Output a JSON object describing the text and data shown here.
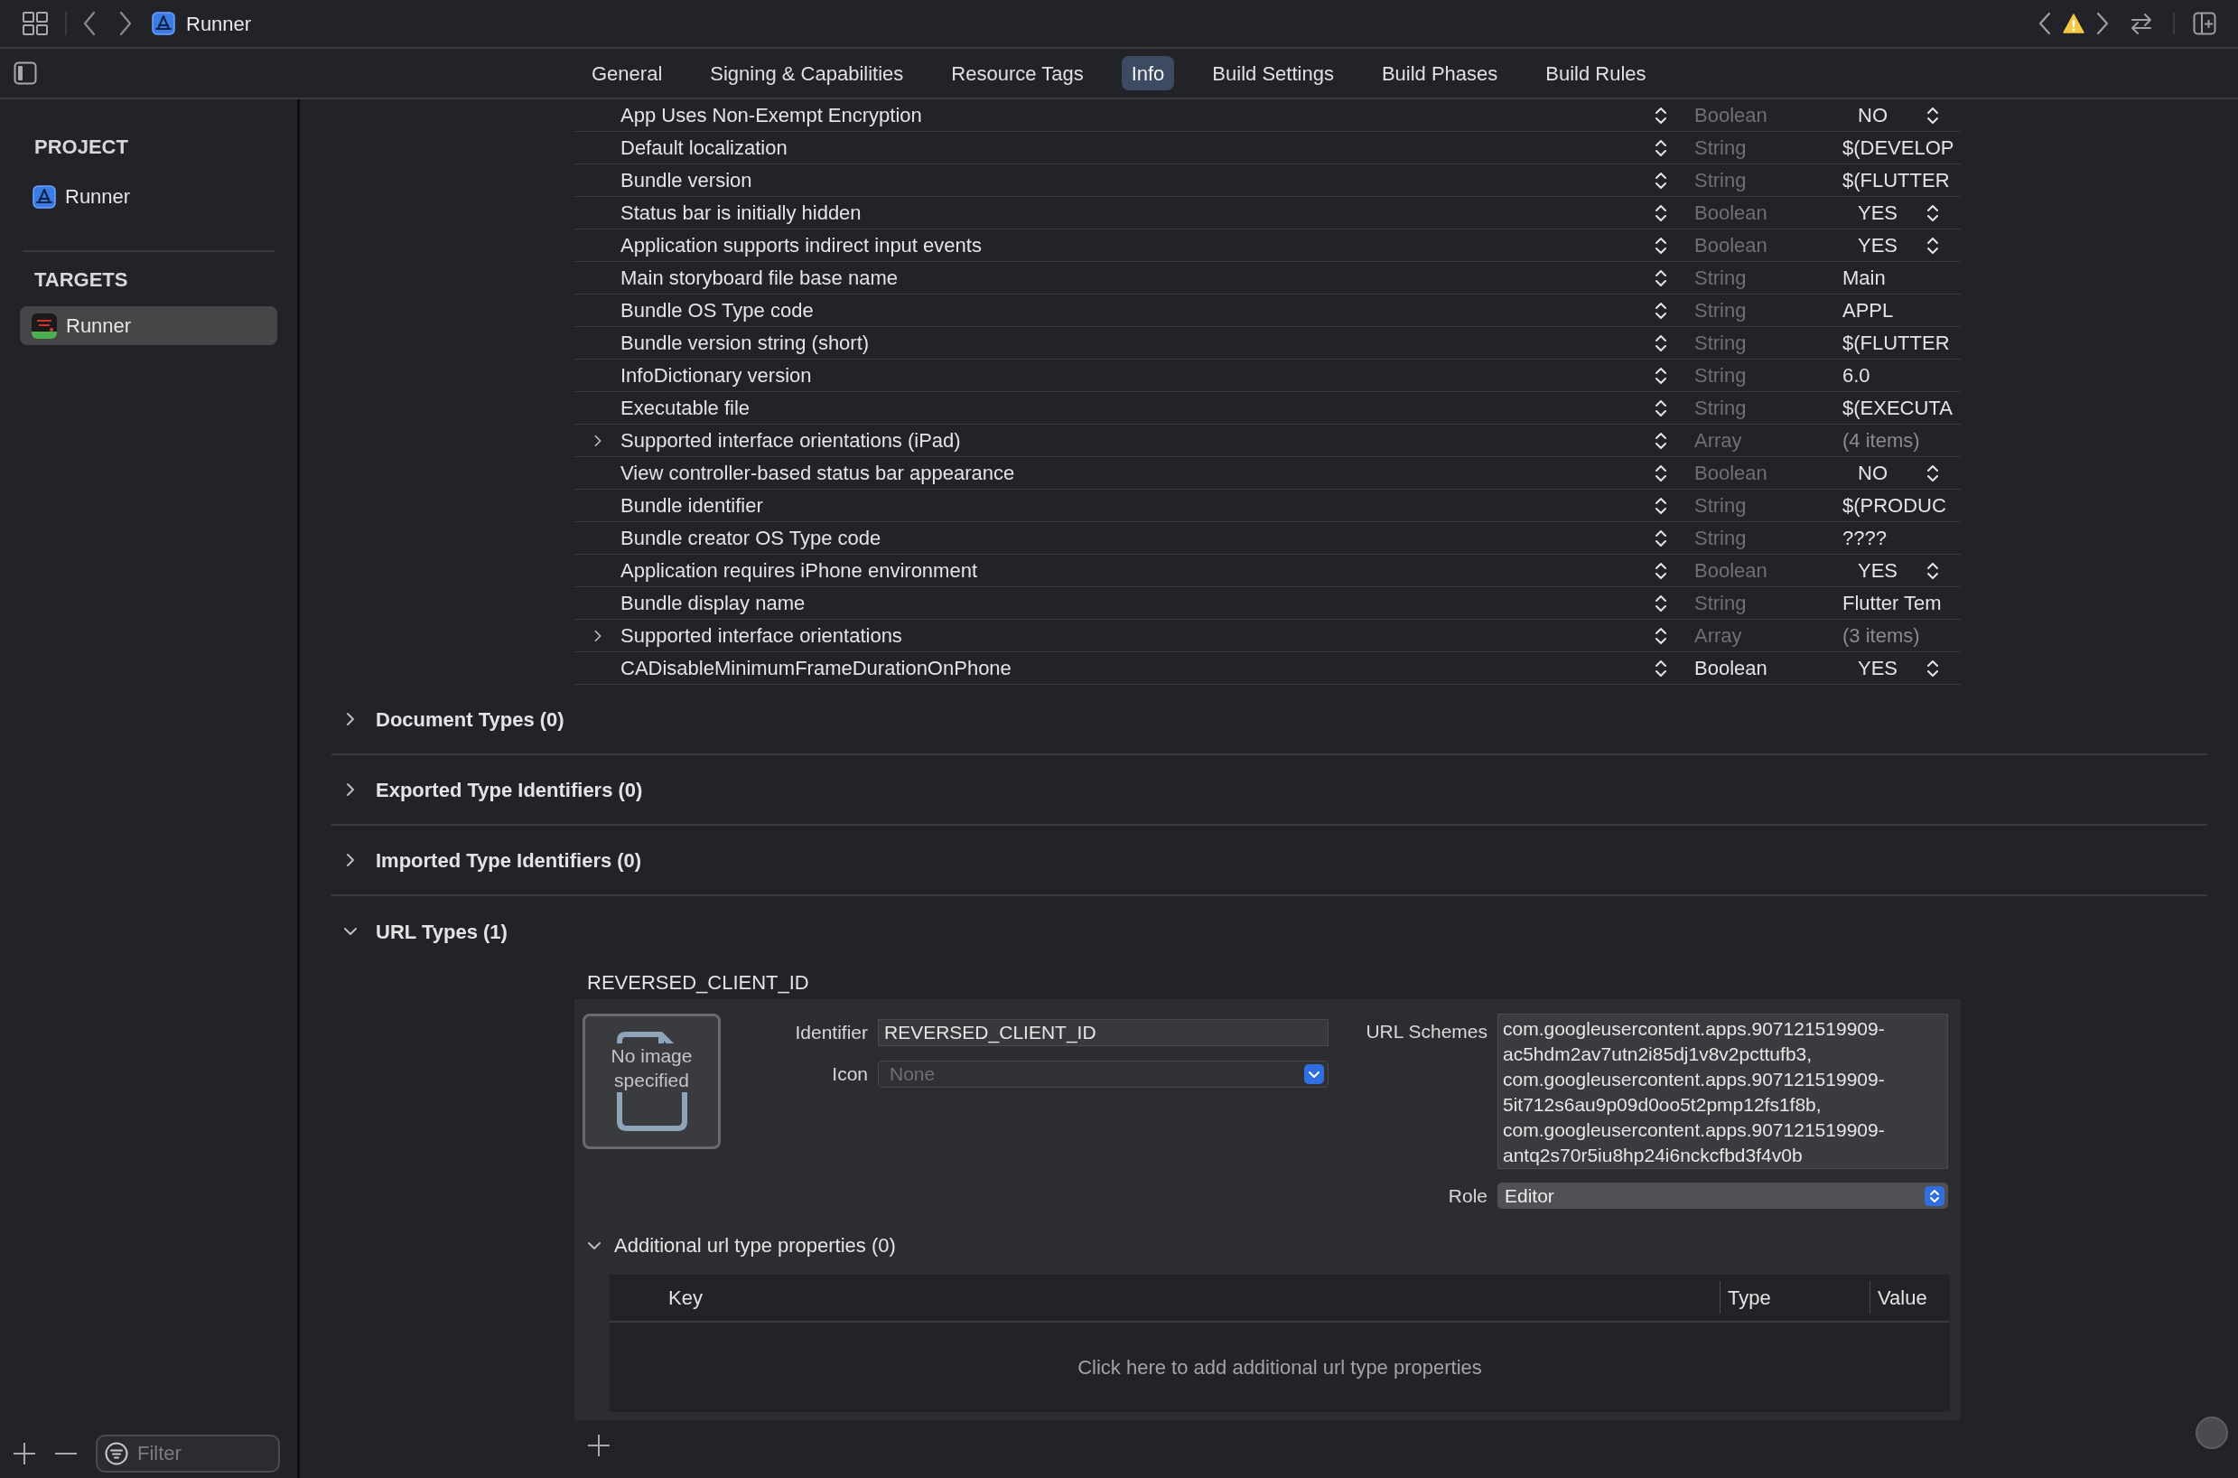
{
  "toolbar": {
    "title": "Runner"
  },
  "tabs": [
    {
      "label": "General",
      "selected": false
    },
    {
      "label": "Signing & Capabilities",
      "selected": false
    },
    {
      "label": "Resource Tags",
      "selected": false
    },
    {
      "label": "Info",
      "selected": true
    },
    {
      "label": "Build Settings",
      "selected": false
    },
    {
      "label": "Build Phases",
      "selected": false
    },
    {
      "label": "Build Rules",
      "selected": false
    }
  ],
  "sidebar": {
    "groups": [
      {
        "heading": "PROJECT",
        "items": [
          {
            "label": "Runner",
            "kind": "project",
            "selected": false
          }
        ]
      },
      {
        "heading": "TARGETS",
        "items": [
          {
            "label": "Runner",
            "kind": "target",
            "selected": true
          }
        ]
      }
    ],
    "filter": {
      "placeholder": "Filter"
    }
  },
  "properties": [
    {
      "key": "App Uses Non-Exempt Encryption",
      "type": "Boolean",
      "value": "NO",
      "kind": "boolean",
      "type_dimmed": true
    },
    {
      "key": "Default localization",
      "type": "String",
      "value": "$(DEVELOP",
      "kind": "string",
      "type_dimmed": true
    },
    {
      "key": "Bundle version",
      "type": "String",
      "value": "$(FLUTTER",
      "kind": "string",
      "type_dimmed": true
    },
    {
      "key": "Status bar is initially hidden",
      "type": "Boolean",
      "value": "YES",
      "kind": "boolean",
      "type_dimmed": true
    },
    {
      "key": "Application supports indirect input events",
      "type": "Boolean",
      "value": "YES",
      "kind": "boolean",
      "type_dimmed": true
    },
    {
      "key": "Main storyboard file base name",
      "type": "String",
      "value": "Main",
      "kind": "string",
      "type_dimmed": true
    },
    {
      "key": "Bundle OS Type code",
      "type": "String",
      "value": "APPL",
      "kind": "string",
      "type_dimmed": true
    },
    {
      "key": "Bundle version string (short)",
      "type": "String",
      "value": "$(FLUTTER",
      "kind": "string",
      "type_dimmed": true
    },
    {
      "key": "InfoDictionary version",
      "type": "String",
      "value": "6.0",
      "kind": "string",
      "type_dimmed": true
    },
    {
      "key": "Executable file",
      "type": "String",
      "value": "$(EXECUTA",
      "kind": "string",
      "type_dimmed": true
    },
    {
      "key": "Supported interface orientations (iPad)",
      "type": "Array",
      "value": "(4 items)",
      "kind": "array",
      "expanded": false,
      "type_dimmed": true
    },
    {
      "key": "View controller-based status bar appearance",
      "type": "Boolean",
      "value": "NO",
      "kind": "boolean",
      "type_dimmed": true
    },
    {
      "key": "Bundle identifier",
      "type": "String",
      "value": "$(PRODUC",
      "kind": "string",
      "type_dimmed": true
    },
    {
      "key": "Bundle creator OS Type code",
      "type": "String",
      "value": "????",
      "kind": "string",
      "type_dimmed": true
    },
    {
      "key": "Application requires iPhone environment",
      "type": "Boolean",
      "value": "YES",
      "kind": "boolean",
      "type_dimmed": true
    },
    {
      "key": "Bundle display name",
      "type": "String",
      "value": "Flutter Tem",
      "kind": "string",
      "type_dimmed": true
    },
    {
      "key": "Supported interface orientations",
      "type": "Array",
      "value": "(3 items)",
      "kind": "array",
      "expanded": false,
      "type_dimmed": true
    },
    {
      "key": "CADisableMinimumFrameDurationOnPhone",
      "type": "Boolean",
      "value": "YES",
      "kind": "boolean",
      "type_dimmed": false
    }
  ],
  "sections": [
    {
      "title": "Document Types (0)",
      "expanded": false
    },
    {
      "title": "Exported Type Identifiers (0)",
      "expanded": false
    },
    {
      "title": "Imported Type Identifiers (0)",
      "expanded": false
    },
    {
      "title": "URL Types (1)",
      "expanded": true
    }
  ],
  "url_type": {
    "heading": "REVERSED_CLIENT_ID",
    "image_placeholder": "No image specified",
    "identifier_label": "Identifier",
    "identifier": "REVERSED_CLIENT_ID",
    "icon_label": "Icon",
    "icon_placeholder": "None",
    "schemes_label": "URL Schemes",
    "schemes": [
      "com.googleusercontent.apps.907121519909-ac5hdm2av7utn2i85dj1v8v2pcttufb3,",
      "com.googleusercontent.apps.907121519909-5it712s6au9p09d0oo5t2pmp12fs1f8b,",
      "com.googleusercontent.apps.907121519909-antq2s70r5iu8hp24i6nckcfbd3f4v0b"
    ],
    "role_label": "Role",
    "role": "Editor",
    "additional": {
      "title": "Additional url type properties (0)",
      "expanded": true,
      "columns": [
        "Key",
        "Type",
        "Value"
      ],
      "empty_text": "Click here to add additional url type properties"
    }
  }
}
